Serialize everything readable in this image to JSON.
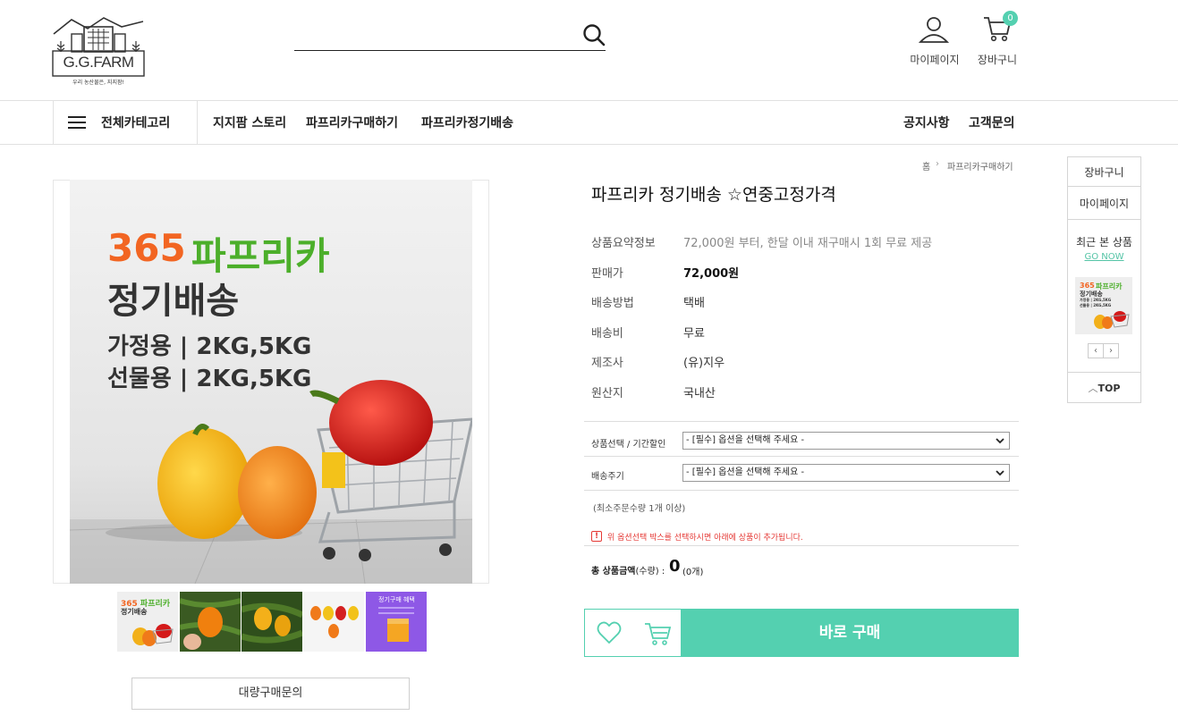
{
  "brand": {
    "name": "G.G.FARM",
    "tagline": "우리 농산물은, 지지팜!"
  },
  "header": {
    "mypage_label": "마이페이지",
    "cart_label": "장바구니",
    "cart_count": "0"
  },
  "nav": {
    "all_categories": "전체카테고리",
    "items": [
      "지지팜 스토리",
      "파프리카구매하기",
      "파프리카정기배송"
    ],
    "right_items": [
      "공지사항",
      "고객문의"
    ]
  },
  "breadcrumb": {
    "home": "홈",
    "current": "파프리카구매하기"
  },
  "product_image": {
    "headline_number": "365",
    "headline_word": "파프리카",
    "line2": "정기배송",
    "line3": "가정용 | 2KG,5KG",
    "line4": "선물용 | 2KG,5KG"
  },
  "thumbnails": {
    "promo_label": "정기구매 혜택"
  },
  "bulk_inquiry_label": "대량구매문의",
  "product": {
    "title": "파프리카 정기배송 ☆연중고정가격",
    "specs": [
      {
        "label": "상품요약정보",
        "value": "72,000원 부터, 한달 이내 재구매시 1회 무료 제공"
      },
      {
        "label": "판매가",
        "value": "72,000원"
      },
      {
        "label": "배송방법",
        "value": "택배"
      },
      {
        "label": "배송비",
        "value": "무료"
      },
      {
        "label": "제조사",
        "value": "(유)지우"
      },
      {
        "label": "원산지",
        "value": "국내산"
      }
    ],
    "options": [
      {
        "label": "상품선택 / 기간할인",
        "selected": "- [필수] 옵션을 선택해 주세요 -"
      },
      {
        "label": "배송주기",
        "selected": "- [필수] 옵션을 선택해 주세요 -"
      }
    ],
    "min_order": "(최소주문수량 1개 이상)",
    "warning": "위 옵션선택 박스를 선택하시면 아래에 상품이 추가됩니다.",
    "warning_icon": "!",
    "total_label": "총 상품금액",
    "total_qty_label": "(수량) :",
    "total_amount": "0",
    "total_count": "(0개)",
    "buy_label": "바로 구매"
  },
  "quick_panel": {
    "cart": "장바구니",
    "mypage": "마이페이지",
    "recent_title": "최근 본 상품",
    "go_now": "GO NOW",
    "recent_thumb": {
      "l1a": "365",
      "l1b": "파프리카",
      "l2": "정기배송",
      "l3": "가정용 | 2KG,5KG",
      "l4": "선물용 | 2KG,5KG"
    },
    "prev": "‹",
    "next": "›",
    "top": "TOP"
  },
  "colors": {
    "accent": "#54d0b0",
    "headline_orange": "#f26522",
    "headline_green": "#4caf2a",
    "warning": "#e53935"
  },
  "icons": [
    "search-icon",
    "user-icon",
    "cart-icon",
    "hamburger-icon",
    "heart-icon",
    "cart-add-icon",
    "chevron-down-icon",
    "chevron-up-icon"
  ]
}
